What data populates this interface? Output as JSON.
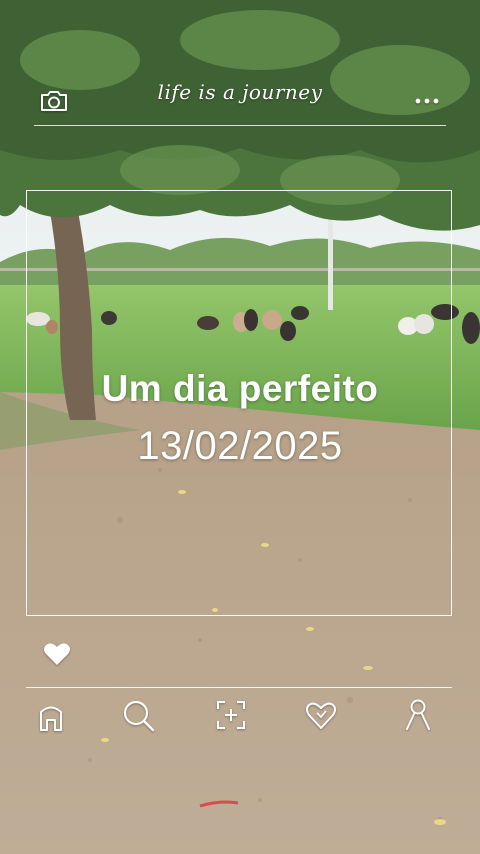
{
  "header": {
    "brand_text": "life is a journey",
    "camera_icon": "camera-icon",
    "menu_icon": "more-horizontal-icon"
  },
  "card": {
    "title": "Um dia perfeito",
    "date": "13/02/2025",
    "like_icon": "heart-icon"
  },
  "bottom_nav": {
    "items": [
      {
        "icon": "home-icon"
      },
      {
        "icon": "search-icon"
      },
      {
        "icon": "add-frame-icon"
      },
      {
        "icon": "heart-outline-icon"
      },
      {
        "icon": "profile-icon"
      }
    ]
  },
  "colors": {
    "overlay_text": "#ffffff",
    "grass": "#6fae4a",
    "soil": "#b39b7f"
  }
}
